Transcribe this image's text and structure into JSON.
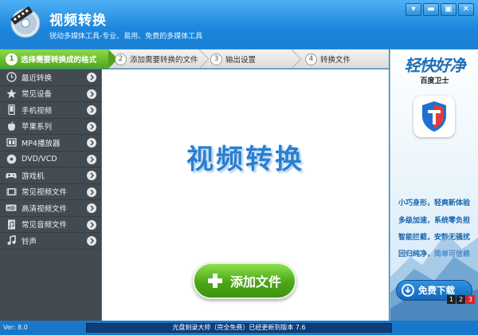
{
  "app": {
    "title": "视频转换",
    "subtitle": "锐动多媒体工具-专业、易用、免费的多媒体工具"
  },
  "window_controls": [
    {
      "name": "menu",
      "glyph": "▾"
    },
    {
      "name": "skin",
      "glyph": "▬"
    },
    {
      "name": "maximize",
      "glyph": "▣"
    },
    {
      "name": "close",
      "glyph": "✕"
    }
  ],
  "steps": [
    {
      "num": "1",
      "label": "选择需要转换成的格式",
      "active": true
    },
    {
      "num": "2",
      "label": "添加需要转换的文件",
      "active": false
    },
    {
      "num": "3",
      "label": "输出设置",
      "active": false
    },
    {
      "num": "4",
      "label": "转换文件",
      "active": false
    }
  ],
  "sidebar": {
    "items": [
      {
        "label": "最近转换",
        "icon": "clock-icon"
      },
      {
        "label": "常见设备",
        "icon": "star-icon"
      },
      {
        "label": "手机视频",
        "icon": "phone-icon"
      },
      {
        "label": "苹果系列",
        "icon": "apple-icon"
      },
      {
        "label": "MP4播放器",
        "icon": "mp4-icon"
      },
      {
        "label": "DVD/VCD",
        "icon": "disc-icon"
      },
      {
        "label": "游戏机",
        "icon": "gamepad-icon"
      },
      {
        "label": "常见视频文件",
        "icon": "film-icon"
      },
      {
        "label": "高清视频文件",
        "icon": "hd-icon"
      },
      {
        "label": "常见音频文件",
        "icon": "audio-icon"
      },
      {
        "label": "铃声",
        "icon": "bell-icon"
      }
    ]
  },
  "main": {
    "hero_title": "视频转换",
    "add_button_label": "添加文件"
  },
  "ad": {
    "brand": "轻快好净",
    "subtitle": "百度卫士",
    "lines": [
      "小巧身形，轻爽新体验",
      "多级加速，系统零负担",
      "智能拦截，安静无骚扰",
      "回归纯净，简单可信赖"
    ],
    "download_label": "免费下载",
    "pages": [
      "1",
      "2",
      "3"
    ],
    "active_page": "3"
  },
  "status": {
    "version": "Ver: 8.0",
    "update_message": "光盘刻录大师（完全免费）已经更新到版本 7.6"
  },
  "colors": {
    "titlebar": "#1b86dc",
    "step_active": "#5fb325",
    "sidebar": "#424a52",
    "hero_text": "#2a7fd1",
    "add_button": "#4ba616",
    "ad_button": "#1467b8"
  }
}
